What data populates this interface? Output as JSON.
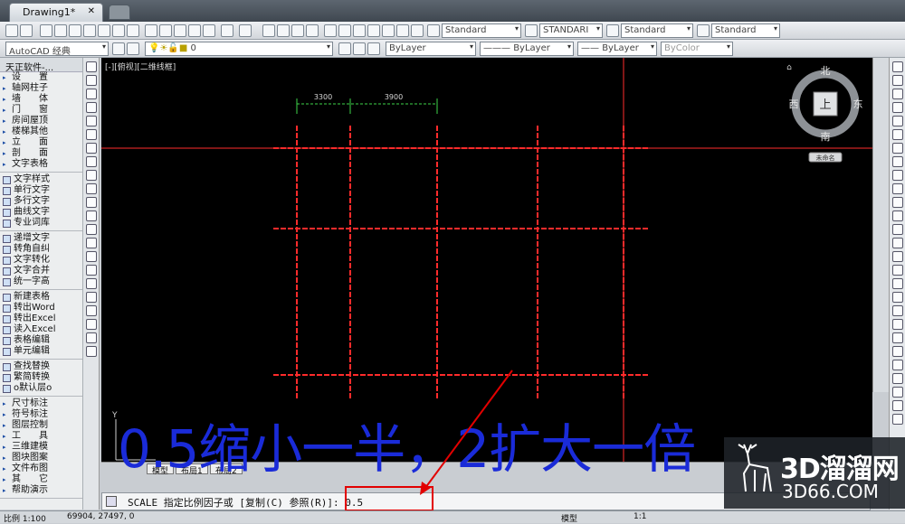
{
  "tabbar": {
    "doc_tab": "Drawing1*",
    "close": "✕"
  },
  "toolbar2": {
    "workspace": "AutoCAD 经典",
    "layer": "0",
    "text_style": "Standard",
    "dim_style": "STANDARI",
    "table_style": "Standard",
    "mleader_style": "Standard",
    "color": "ByLayer",
    "linetype": "ByLayer",
    "lineweight": "ByLayer",
    "plotstyle": "ByColor"
  },
  "leftpanel": {
    "title": "天正软件-...",
    "group1": [
      "设　　置",
      "轴网柱子",
      "墙　　体",
      "门　　窗",
      "房间屋顶",
      "楼梯其他",
      "立　　面",
      "剖　　面",
      "文字表格"
    ],
    "group2": [
      "文字样式",
      "单行文字",
      "多行文字",
      "曲线文字",
      "专业词库"
    ],
    "group3": [
      "递增文字",
      "转角自纠",
      "文字转化",
      "文字合并",
      "统一字高"
    ],
    "group4": [
      "新建表格",
      "转出Word",
      "转出Excel",
      "读入Excel",
      "表格编辑",
      "单元编辑"
    ],
    "group5": [
      "查找替换",
      "繁简转换",
      "o默认层o"
    ],
    "group6": [
      "尺寸标注",
      "符号标注",
      "图层控制",
      "工　　具",
      "三维建模",
      "图块图案",
      "文件布图",
      "其　　它",
      "帮助演示"
    ]
  },
  "canvas": {
    "viewport_label": "[-][俯视][二维线框]",
    "dim1": "3300",
    "dim2": "3900",
    "viewcube": {
      "north": "北",
      "south": "南",
      "east": "东",
      "west": "西",
      "top": "上",
      "wcs": "未命名"
    }
  },
  "model_tabs": [
    "模型",
    "布局1",
    "布局2"
  ],
  "command": {
    "prompt": "SCALE 指定比例因子或 [复制(C) 参照(R)]: ",
    "value": "0.5"
  },
  "status": {
    "scale": "比例 1:100",
    "coords": "69904, 27497, 0",
    "model": "模型",
    "anno": "1:1"
  },
  "overlay": {
    "caption": "0.5缩小一半，2扩大一倍",
    "brand_cn": "3D溜溜网",
    "brand_url": "3D66.COM"
  },
  "colors": {
    "grid_red": "#ff2b2b",
    "dim_green": "#3ed44a",
    "caption_blue": "#1a2bd8"
  }
}
